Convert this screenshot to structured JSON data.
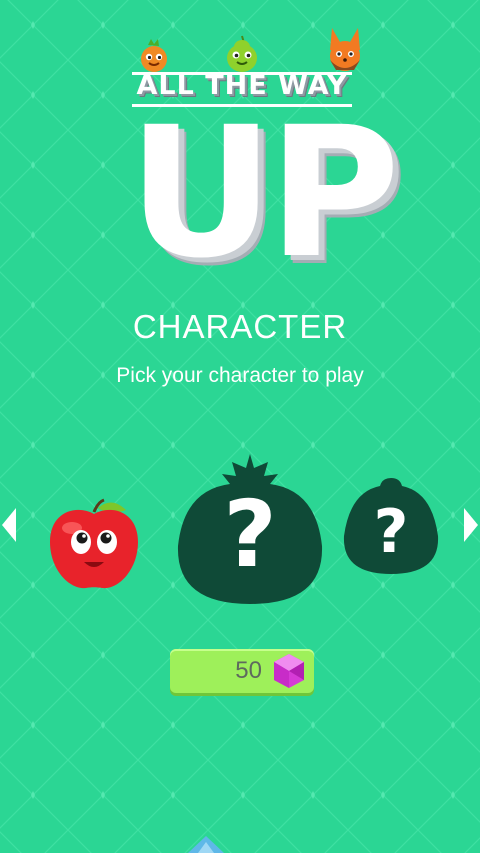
{
  "logo": {
    "subtitle": "ALL THE WAY",
    "title": "UP",
    "mascots": [
      "orange-mascot-icon",
      "green-pear-mascot-icon",
      "fox-mascot-icon"
    ]
  },
  "screen": {
    "heading": "CHARACTER",
    "instruction": "Pick your character to play"
  },
  "carousel": {
    "characters": [
      {
        "name": "apple",
        "locked": false,
        "icon": "apple-character-icon"
      },
      {
        "name": "mystery-tomato",
        "locked": true,
        "label": "?",
        "icon": "locked-character-silhouette-icon"
      },
      {
        "name": "mystery-blob",
        "locked": true,
        "label": "?",
        "icon": "locked-character-silhouette-icon"
      }
    ],
    "prev_icon": "chevron-left-icon",
    "next_icon": "chevron-right-icon"
  },
  "currency": {
    "gems": "50",
    "icon": "pink-gem-icon"
  },
  "colors": {
    "background": "#2bd694",
    "silhouette": "#0f4a37",
    "gem_panel": "#9ef05a",
    "gem": "#d63bd6",
    "apple": "#e8232b"
  }
}
